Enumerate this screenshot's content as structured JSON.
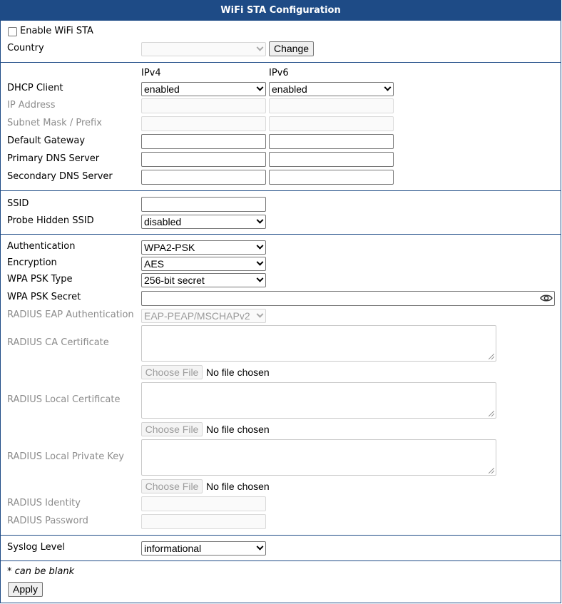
{
  "title": "WiFi STA Configuration",
  "enable": {
    "label": "Enable WiFi STA",
    "checked": false
  },
  "country": {
    "label": "Country",
    "value": "",
    "change_label": "Change"
  },
  "ip": {
    "ipv4_header": "IPv4",
    "ipv6_header": "IPv6",
    "dhcp_label": "DHCP Client",
    "dhcp_ipv4": "enabled",
    "dhcp_ipv6": "enabled",
    "ip_address_label": "IP Address",
    "subnet_label": "Subnet Mask / Prefix",
    "gateway_label": "Default Gateway",
    "primary_dns_label": "Primary DNS Server",
    "secondary_dns_label": "Secondary DNS Server"
  },
  "wifi": {
    "ssid_label": "SSID",
    "probe_label": "Probe Hidden SSID",
    "probe_value": "disabled"
  },
  "security": {
    "auth_label": "Authentication",
    "auth_value": "WPA2-PSK",
    "enc_label": "Encryption",
    "enc_value": "AES",
    "psk_type_label": "WPA PSK Type",
    "psk_type_value": "256-bit secret",
    "psk_secret_label": "WPA PSK Secret",
    "eap_label": "RADIUS EAP Authentication",
    "eap_value": "EAP-PEAP/MSCHAPv2",
    "ca_label": "RADIUS CA Certificate",
    "local_cert_label": "RADIUS Local Certificate",
    "private_key_label": "RADIUS Local Private Key",
    "identity_label": "RADIUS Identity",
    "password_label": "RADIUS Password",
    "choose_file_label": "Choose File",
    "no_file_label": "No file chosen"
  },
  "syslog": {
    "label": "Syslog Level",
    "value": "informational"
  },
  "footer": {
    "note": "* can be blank",
    "apply_label": "Apply"
  },
  "colors": {
    "accent": "#1e4b86",
    "disabled_text": "#8c8c8c"
  },
  "icons": {
    "password_toggle": "eye-icon",
    "select_caret": "chevron-down-icon"
  }
}
